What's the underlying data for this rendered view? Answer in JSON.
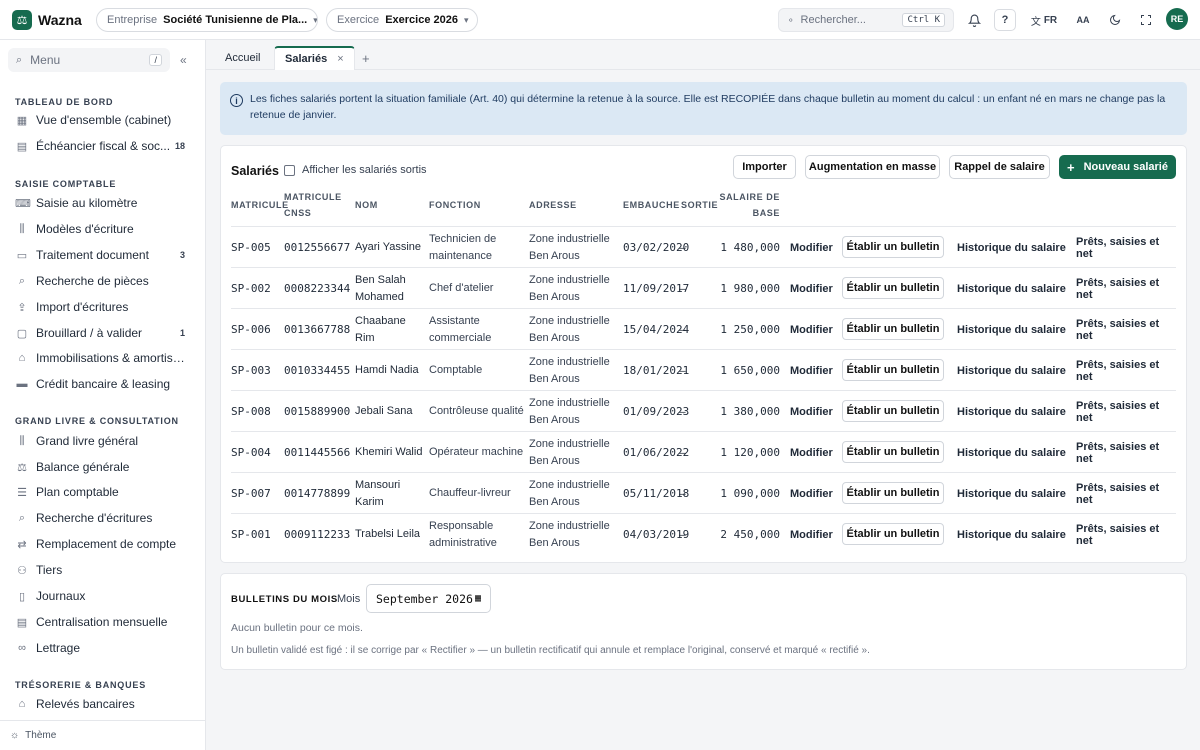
{
  "app": {
    "name": "Wazna",
    "logo_icon": "scale-icon"
  },
  "header": {
    "entreprise_label": "Entreprise",
    "entreprise_value": "Société Tunisienne de Pla...",
    "exercice_label": "Exercice",
    "exercice_value": "Exercice 2026",
    "search_placeholder": "Rechercher...",
    "search_shortcut": "Ctrl K",
    "help_label": "?",
    "lang": "FR",
    "text_size_label": "AA",
    "avatar_initials": "RE"
  },
  "sidebar": {
    "search_placeholder": "Menu",
    "search_shortcut": "/",
    "sections": [
      {
        "title": "TABLEAU DE BORD",
        "items": [
          {
            "label": "Vue d'ensemble (cabinet)",
            "icon": "grid-icon",
            "badge": ""
          },
          {
            "label": "Échéancier fiscal & soc...",
            "icon": "calendar-icon",
            "badge": "18"
          }
        ]
      },
      {
        "title": "SAISIE COMPTABLE",
        "items": [
          {
            "label": "Saisie au kilomètre",
            "icon": "keyboard-icon",
            "badge": ""
          },
          {
            "label": "Modèles d'écriture",
            "icon": "library-icon",
            "badge": ""
          },
          {
            "label": "Traitement document",
            "icon": "document-icon",
            "badge": "3"
          },
          {
            "label": "Recherche de pièces",
            "icon": "search-icon",
            "badge": ""
          },
          {
            "label": "Import d'écritures",
            "icon": "upload-icon",
            "badge": ""
          },
          {
            "label": "Brouillard / à valider",
            "icon": "draft-icon",
            "badge": "1"
          },
          {
            "label": "Immobilisations & amortisse...",
            "icon": "building-icon",
            "badge": ""
          },
          {
            "label": "Crédit bancaire & leasing",
            "icon": "credit-card-icon",
            "badge": ""
          }
        ]
      },
      {
        "title": "GRAND LIVRE & CONSULTATION",
        "items": [
          {
            "label": "Grand livre général",
            "icon": "library-icon",
            "badge": ""
          },
          {
            "label": "Balance générale",
            "icon": "scale-icon",
            "badge": ""
          },
          {
            "label": "Plan comptable",
            "icon": "list-icon",
            "badge": ""
          },
          {
            "label": "Recherche d'écritures",
            "icon": "search-icon",
            "badge": ""
          },
          {
            "label": "Remplacement de compte",
            "icon": "swap-icon",
            "badge": ""
          },
          {
            "label": "Tiers",
            "icon": "users-icon",
            "badge": ""
          },
          {
            "label": "Journaux",
            "icon": "book-icon",
            "badge": ""
          },
          {
            "label": "Centralisation mensuelle",
            "icon": "file-icon",
            "badge": ""
          },
          {
            "label": "Lettrage",
            "icon": "link-icon",
            "badge": ""
          }
        ]
      },
      {
        "title": "TRÉSORERIE & BANQUES",
        "items": [
          {
            "label": "Relevés bancaires",
            "icon": "bank-icon",
            "badge": ""
          }
        ]
      }
    ],
    "footer_label": "Thème"
  },
  "tabs": [
    {
      "label": "Accueil",
      "active": false
    },
    {
      "label": "Salariés",
      "active": true,
      "close": "×"
    }
  ],
  "tab_add": "+",
  "banner_text": "Les fiches salariés portent la situation familiale (Art. 40) qui détermine la retenue à la source. Elle est RECOPIÉE dans chaque bulletin au moment du calcul : un enfant né en mars ne change pas la retenue de janvier.",
  "salaries": {
    "title": "Salariés",
    "show_exited_label": "Afficher les salariés sortis",
    "buttons": {
      "import": "Importer",
      "mass_raise": "Augmentation en masse",
      "recall": "Rappel de salaire",
      "new": "Nouveau salarié"
    },
    "columns": {
      "matricule": "MATRICULE",
      "cnss": "MATRICULE CNSS",
      "nom": "NOM",
      "fonction": "FONCTION",
      "adresse": "ADRESSE",
      "embauche": "EMBAUCHE",
      "sortie": "SORTIE",
      "salaire": "SALAIRE DE BASE"
    },
    "row_actions": {
      "edit": "Modifier",
      "payslip": "Établir un bulletin",
      "history": "Historique du salaire",
      "loans": "Prêts, saisies et net"
    },
    "rows": [
      {
        "matricule": "SP-005",
        "cnss": "0012556677",
        "nom": "Ayari Yassine",
        "fonction": "Technicien de maintenance",
        "adresse": "Zone industrielle Ben Arous",
        "embauche": "03/02/2020",
        "sortie": "—",
        "salaire": "1 480,000"
      },
      {
        "matricule": "SP-002",
        "cnss": "0008223344",
        "nom": "Ben Salah Mohamed",
        "fonction": "Chef d'atelier",
        "adresse": "Zone industrielle Ben Arous",
        "embauche": "11/09/2017",
        "sortie": "—",
        "salaire": "1 980,000"
      },
      {
        "matricule": "SP-006",
        "cnss": "0013667788",
        "nom": "Chaabane Rim",
        "fonction": "Assistante commerciale",
        "adresse": "Zone industrielle Ben Arous",
        "embauche": "15/04/2024",
        "sortie": "—",
        "salaire": "1 250,000"
      },
      {
        "matricule": "SP-003",
        "cnss": "0010334455",
        "nom": "Hamdi Nadia",
        "fonction": "Comptable",
        "adresse": "Zone industrielle Ben Arous",
        "embauche": "18/01/2021",
        "sortie": "—",
        "salaire": "1 650,000"
      },
      {
        "matricule": "SP-008",
        "cnss": "0015889900",
        "nom": "Jebali Sana",
        "fonction": "Contrôleuse qualité",
        "adresse": "Zone industrielle Ben Arous",
        "embauche": "01/09/2023",
        "sortie": "—",
        "salaire": "1 380,000"
      },
      {
        "matricule": "SP-004",
        "cnss": "0011445566",
        "nom": "Khemiri Walid",
        "fonction": "Opérateur machine",
        "adresse": "Zone industrielle Ben Arous",
        "embauche": "01/06/2022",
        "sortie": "—",
        "salaire": "1 120,000"
      },
      {
        "matricule": "SP-007",
        "cnss": "0014778899",
        "nom": "Mansouri Karim",
        "fonction": "Chauffeur-livreur",
        "adresse": "Zone industrielle Ben Arous",
        "embauche": "05/11/2018",
        "sortie": "—",
        "salaire": "1 090,000"
      },
      {
        "matricule": "SP-001",
        "cnss": "0009112233",
        "nom": "Trabelsi Leila",
        "fonction": "Responsable administrative",
        "adresse": "Zone industrielle Ben Arous",
        "embauche": "04/03/2019",
        "sortie": "—",
        "salaire": "2 450,000"
      }
    ]
  },
  "bulletins": {
    "title": "BULLETINS DU MOIS",
    "month_label": "Mois",
    "month_value": "September 2026",
    "empty": "Aucun bulletin pour ce mois.",
    "note": "Un bulletin validé est figé : il se corrige par « Rectifier » — un bulletin rectificatif qui annule et remplace l'original, conservé et marqué « rectifié »."
  },
  "colors": {
    "brand": "#166b4f",
    "banner_bg": "#dbe8f4"
  }
}
